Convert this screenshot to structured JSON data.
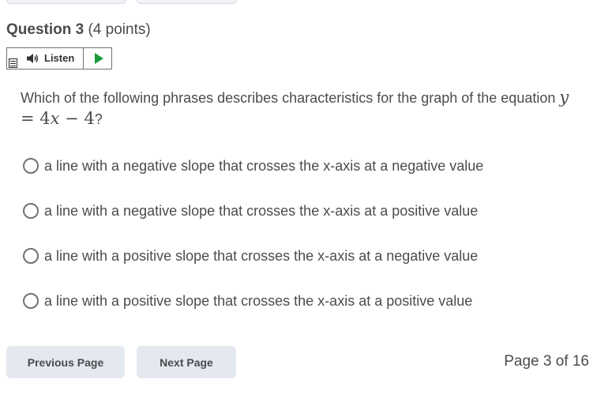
{
  "question": {
    "title": "Question 3",
    "points": "(4 points)",
    "prompt_before": "Which of the following phrases describes characteristics for the graph of the equation ",
    "equation": {
      "y": "y",
      "eq": " = ",
      "coef": "4",
      "x": "x",
      "minus": " − ",
      "const": "4"
    },
    "prompt_after": "?"
  },
  "listen": {
    "label": "Listen",
    "speaker_icon": "speaker-icon",
    "play_icon": "play-icon",
    "doc_icon": "document-icon",
    "play_color": "#1a9a3a"
  },
  "options": [
    {
      "label": "a line with a negative slope that crosses the x-axis at a negative value"
    },
    {
      "label": "a line with a negative slope that crosses the x-axis at a positive value"
    },
    {
      "label": "a line with a positive slope that crosses the x-axis at a negative value"
    },
    {
      "label": "a line with a positive slope that crosses the x-axis at a positive value"
    }
  ],
  "nav": {
    "previous_label": "Previous Page",
    "next_label": "Next Page",
    "page_indicator": "Page 3 of 16"
  },
  "colors": {
    "text": "#494c4e",
    "button_bg": "#e4e9f0"
  }
}
